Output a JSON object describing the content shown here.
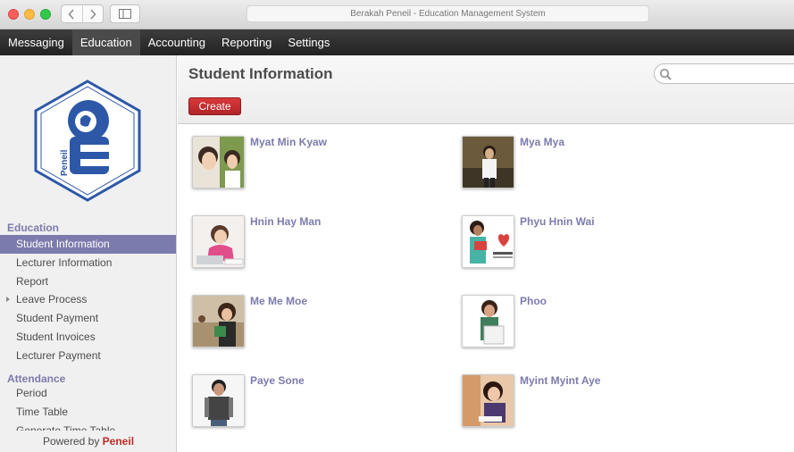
{
  "window": {
    "title": "Berakah Peneil - Education Management System"
  },
  "topmenu": {
    "items": [
      {
        "label": "Messaging"
      },
      {
        "label": "Education"
      },
      {
        "label": "Accounting"
      },
      {
        "label": "Reporting"
      },
      {
        "label": "Settings"
      }
    ],
    "active": "Education"
  },
  "sidebar": {
    "logo_text": "Peneil",
    "education_title": "Education",
    "education_items": [
      {
        "label": "Student Information"
      },
      {
        "label": "Lecturer Information"
      },
      {
        "label": "Report"
      },
      {
        "label": "Leave Process"
      },
      {
        "label": "Student Payment"
      },
      {
        "label": "Student Invoices"
      },
      {
        "label": "Lecturer Payment"
      }
    ],
    "attendance_title": "Attendance",
    "attendance_items": [
      {
        "label": "Period"
      },
      {
        "label": "Time Table"
      },
      {
        "label": "Generate Time Table"
      }
    ],
    "powered_prefix": "Powered by",
    "powered_brand": "Peneil"
  },
  "main": {
    "title": "Student Information",
    "create_label": "Create",
    "search_placeholder": "",
    "students": [
      {
        "name": "Myat Min Kyaw"
      },
      {
        "name": "Mya Mya"
      },
      {
        "name": "Hnin Hay Man"
      },
      {
        "name": "Phyu Hnin Wai"
      },
      {
        "name": "Me Me Moe"
      },
      {
        "name": "Phoo"
      },
      {
        "name": "Paye Sone"
      },
      {
        "name": "Myint Myint Aye"
      }
    ]
  },
  "colors": {
    "accent": "#7c7bad",
    "create_button": "#c3292d",
    "menu_bar": "#2e2e2e"
  }
}
